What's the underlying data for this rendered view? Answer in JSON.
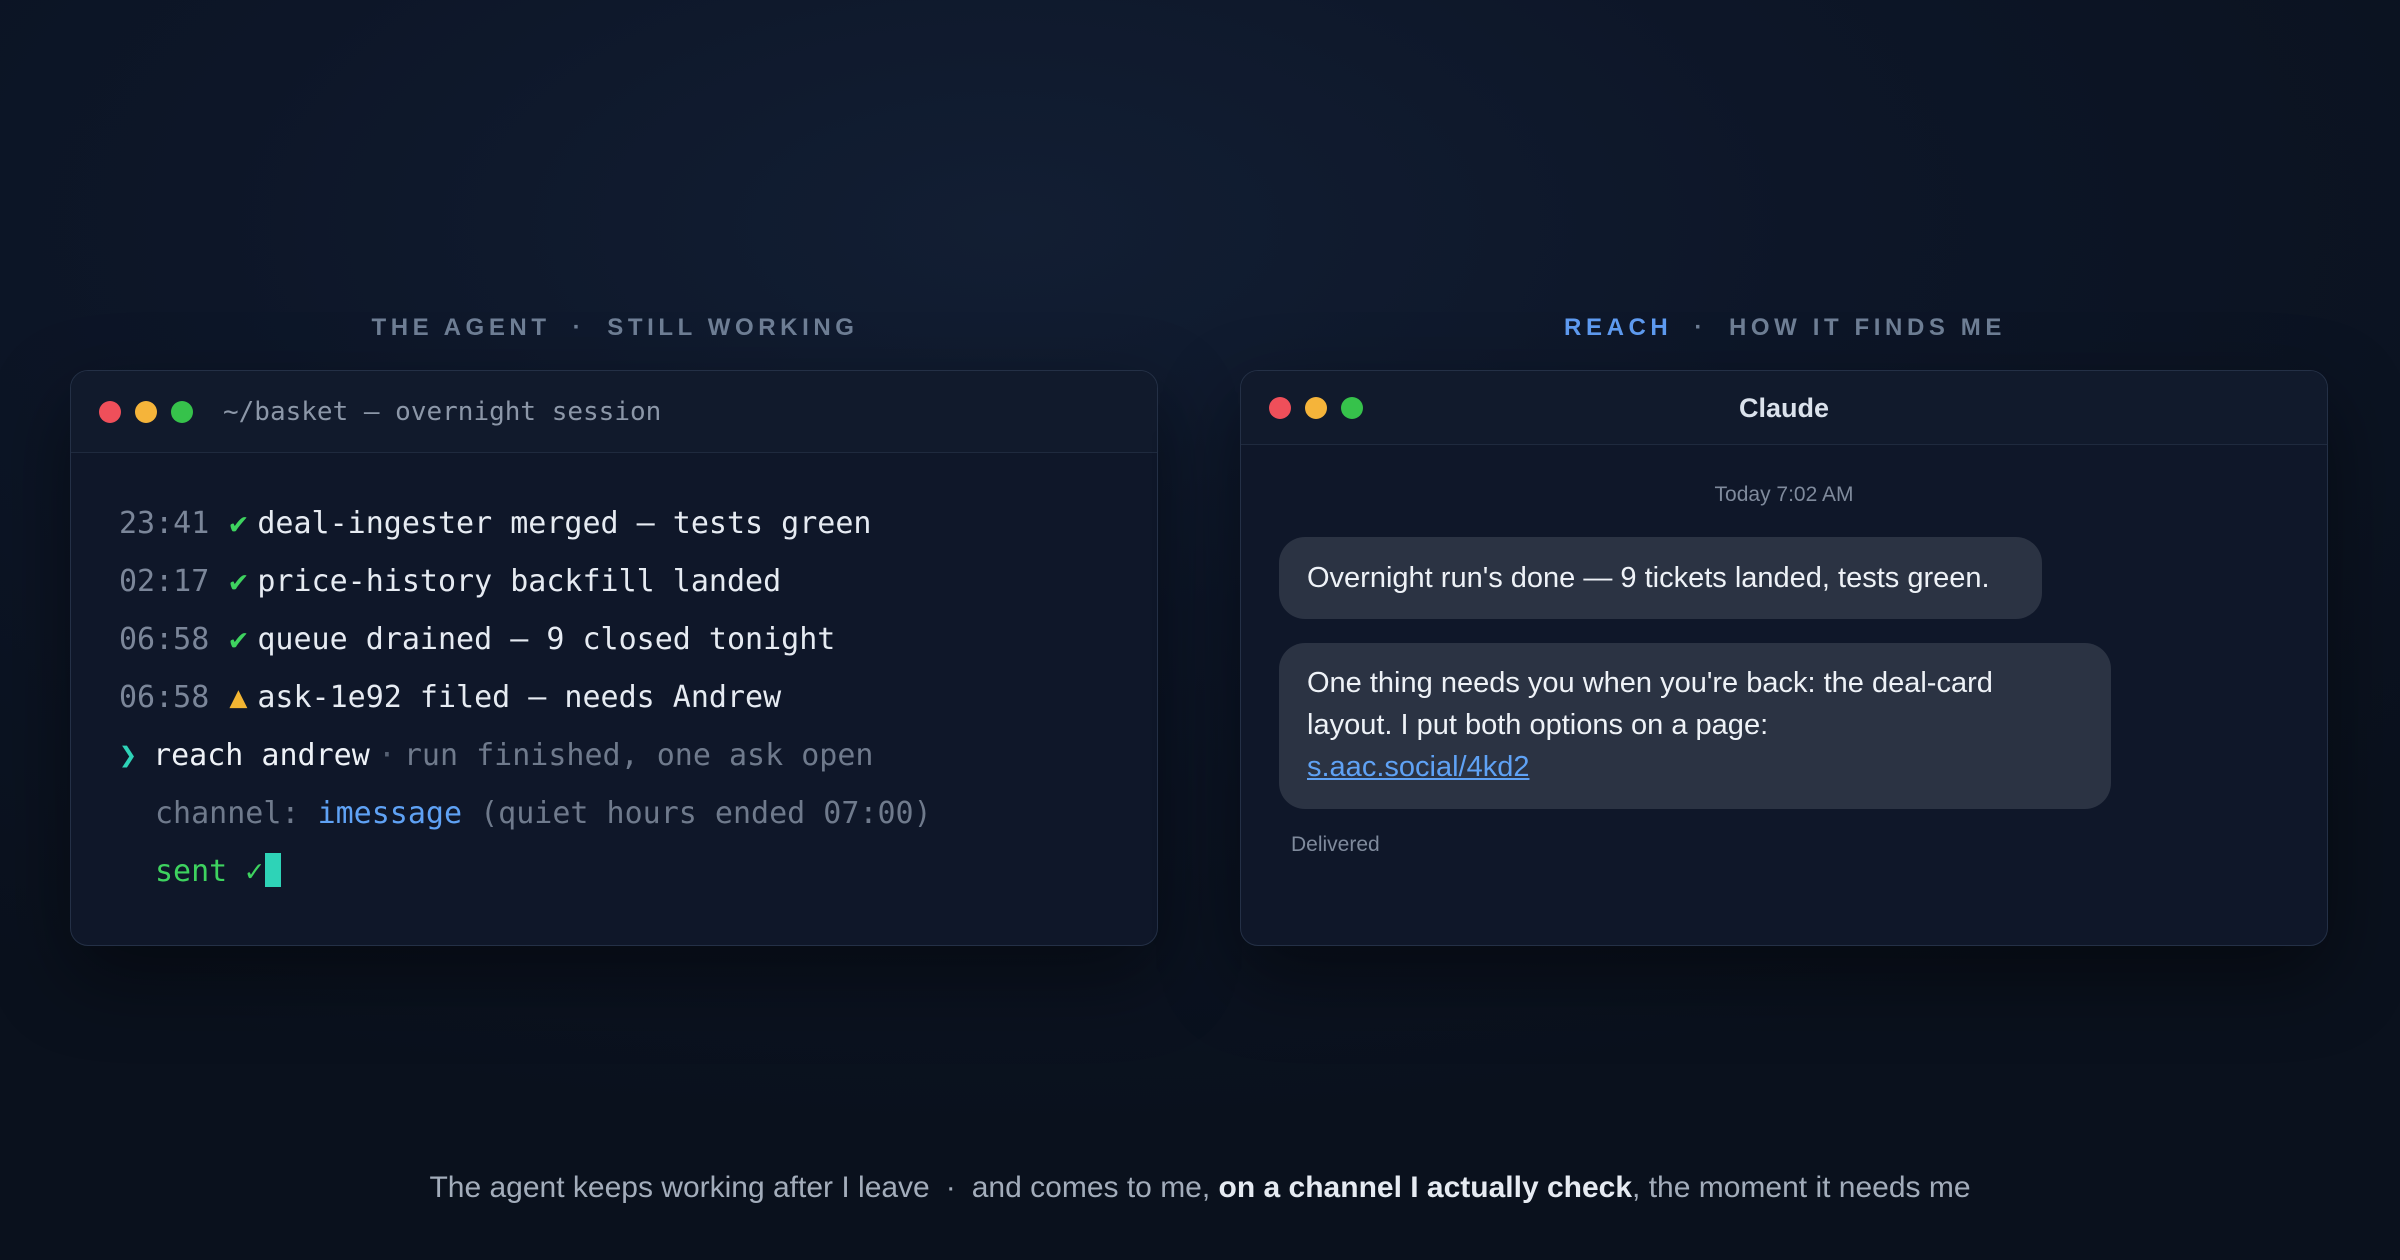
{
  "sections": {
    "left": {
      "part1": "THE AGENT",
      "sep": "·",
      "part2": "STILL WORKING"
    },
    "right": {
      "accent": "REACH",
      "sep": "·",
      "part2": "HOW IT FINDS ME"
    }
  },
  "terminal": {
    "title": "~/basket — overnight session",
    "lines": [
      {
        "time": "23:41",
        "mark": "✔",
        "text": "deal-ingester merged — tests green"
      },
      {
        "time": "02:17",
        "mark": "✔",
        "text": "price-history backfill landed"
      },
      {
        "time": "06:58",
        "mark": "✔",
        "text": "queue drained — 9 closed tonight"
      },
      {
        "time": "06:58",
        "mark": "▲",
        "text": "ask-1e92 filed — needs Andrew"
      }
    ],
    "prompt": {
      "symbol": "❯",
      "command": "reach andrew",
      "sep": "·",
      "note": "run finished, one ask open"
    },
    "channel": {
      "label": "channel:",
      "value": "imessage",
      "note": "(quiet hours ended 07:00)"
    },
    "sent": "sent ✓"
  },
  "chat": {
    "title": "Claude",
    "timestamp": "Today 7:02 AM",
    "message1": "Overnight run's done — 9 tickets landed, tests green.",
    "message2_text": "One thing needs you when you're back: the deal-card layout. I put both options on a page:",
    "message2_link": "s.aac.social/4kd2",
    "status": "Delivered"
  },
  "caption": {
    "part1": "The agent keeps working after I leave",
    "sep": "·",
    "part2": "and comes to me,",
    "bold": "on a channel I actually check",
    "part3": ", the moment it needs me"
  },
  "colors": {
    "background": "#0d1628",
    "accent_blue": "#5f9cf2",
    "ok_green": "#3ed35f",
    "warn_yellow": "#f2b532",
    "prompt_teal": "#2ed3b7"
  }
}
